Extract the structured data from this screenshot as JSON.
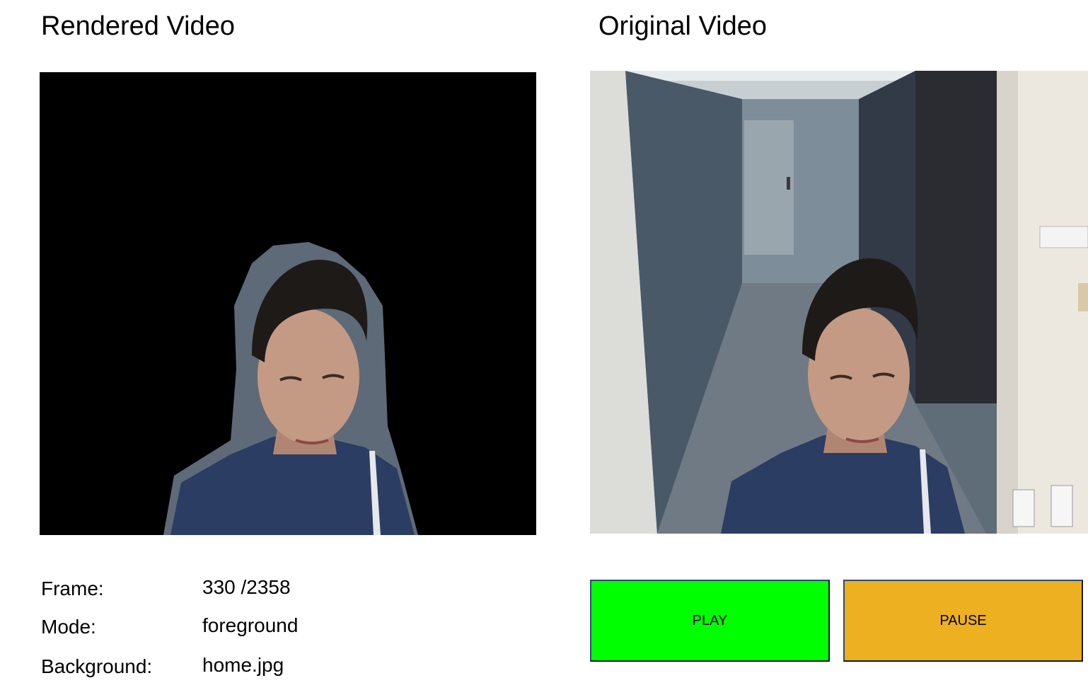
{
  "panels": {
    "rendered_title": "Rendered Video",
    "original_title": "Original Video"
  },
  "info": {
    "frame_label": "Frame:",
    "frame_value": "330 /2358",
    "mode_label": "Mode:",
    "mode_value": "foreground",
    "background_label": "Background:",
    "background_value": "home.jpg"
  },
  "controls": {
    "play_label": "PLAY",
    "pause_label": "PAUSE",
    "play_color": "#00ff00",
    "pause_color": "#ecb020"
  }
}
